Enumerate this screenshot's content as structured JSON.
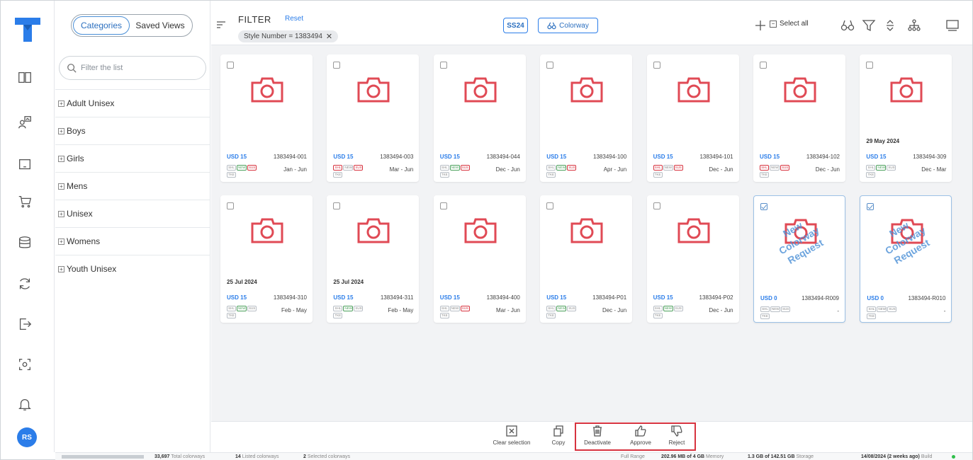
{
  "brand": {
    "logo_color": "#2b7de9",
    "accent": "#2b7de9",
    "highlight": "#d7333f"
  },
  "rail": {
    "icons": [
      "book-icon",
      "people-chart-icon",
      "laptop-icon",
      "cart-icon",
      "database-icon",
      "sync-icon",
      "export-icon",
      "scan-icon",
      "bell-icon"
    ],
    "avatar_initials": "RS"
  },
  "categories": {
    "tabs": {
      "categories": "Categories",
      "saved_views": "Saved Views"
    },
    "search_placeholder": "Filter the list",
    "items": [
      "Adult Unisex",
      "Boys",
      "Girls",
      "Mens",
      "Unisex",
      "Womens",
      "Youth Unisex"
    ]
  },
  "toolbar": {
    "filter_title": "FILTER",
    "reset": "Reset",
    "active_filter": "Style Number = 1383494",
    "season": "SS24",
    "colorway": "Colorway",
    "select_all": "Select all"
  },
  "cards": [
    {
      "price": "USD 15",
      "code": "1383494-001",
      "range": "Jan - Jun",
      "date": "",
      "badges": [
        "SHL",
        "NEW",
        "SUS",
        "TKE"
      ],
      "highlights": {
        "NEW": "green",
        "SUS": "red"
      },
      "selected": false,
      "overlay": false
    },
    {
      "price": "USD 15",
      "code": "1383494-003",
      "range": "Mar - Jun",
      "date": "",
      "badges": [
        "SHL",
        "NEW",
        "SUS",
        "TKE"
      ],
      "highlights": {
        "SHL": "red",
        "SUS": "red"
      },
      "selected": false,
      "overlay": false
    },
    {
      "price": "USD 15",
      "code": "1383494-044",
      "range": "Dec - Jun",
      "date": "",
      "badges": [
        "SHL",
        "NEW",
        "SUS",
        "TKE"
      ],
      "highlights": {
        "NEW": "green",
        "SUS": "red"
      },
      "selected": false,
      "overlay": false
    },
    {
      "price": "USD 15",
      "code": "1383494-100",
      "range": "Apr - Jun",
      "date": "",
      "badges": [
        "SHL",
        "NEW",
        "SUS",
        "TKE"
      ],
      "highlights": {
        "NEW": "green",
        "SUS": "red"
      },
      "selected": false,
      "overlay": false
    },
    {
      "price": "USD 15",
      "code": "1383494-101",
      "range": "Dec - Jun",
      "date": "",
      "badges": [
        "SHL",
        "NEW",
        "SUS",
        "TKE"
      ],
      "highlights": {
        "SHL": "red",
        "SUS": "red"
      },
      "selected": false,
      "overlay": false
    },
    {
      "price": "USD 15",
      "code": "1383494-102",
      "range": "Dec - Jun",
      "date": "",
      "badges": [
        "SHL",
        "NEW",
        "SUS",
        "TKE"
      ],
      "highlights": {
        "SHL": "red",
        "SUS": "red"
      },
      "selected": false,
      "overlay": false
    },
    {
      "price": "USD 15",
      "code": "1383494-309",
      "range": "Dec - Mar",
      "date": "29 May 2024",
      "badges": [
        "SHL",
        "NEW",
        "SUS",
        "TKE"
      ],
      "highlights": {
        "NEW": "green"
      },
      "selected": false,
      "overlay": false
    },
    {
      "price": "USD 15",
      "code": "1383494-310",
      "range": "Feb - May",
      "date": "25 Jul 2024",
      "badges": [
        "SHL",
        "NEW",
        "SUS",
        "TKE"
      ],
      "highlights": {
        "NEW": "green"
      },
      "selected": false,
      "overlay": false
    },
    {
      "price": "USD 15",
      "code": "1383494-311",
      "range": "Feb - May",
      "date": "25 Jul 2024",
      "badges": [
        "SHL",
        "NEW",
        "SUS",
        "TKE"
      ],
      "highlights": {
        "NEW": "green"
      },
      "selected": false,
      "overlay": false
    },
    {
      "price": "USD 15",
      "code": "1383494-400",
      "range": "Mar - Jun",
      "date": "",
      "badges": [
        "SHL",
        "NEW",
        "SUS",
        "TKE"
      ],
      "highlights": {
        "SUS": "red"
      },
      "selected": false,
      "overlay": false
    },
    {
      "price": "USD 15",
      "code": "1383494-P01",
      "range": "Dec - Jun",
      "date": "",
      "badges": [
        "SHL",
        "NEW",
        "SUS",
        "TKE"
      ],
      "highlights": {
        "NEW": "green"
      },
      "selected": false,
      "overlay": false
    },
    {
      "price": "USD 15",
      "code": "1383494-P02",
      "range": "Dec - Jun",
      "date": "",
      "badges": [
        "SHL",
        "NEW",
        "SUS",
        "TKE"
      ],
      "highlights": {
        "NEW": "green"
      },
      "selected": false,
      "overlay": false
    },
    {
      "price": "USD 0",
      "code": "1383494-R009",
      "range": "-",
      "date": "",
      "badges": [
        "SHL",
        "NEW",
        "SUS",
        "TKE"
      ],
      "highlights": {},
      "selected": true,
      "overlay": true
    },
    {
      "price": "USD 0",
      "code": "1383494-R010",
      "range": "-",
      "date": "",
      "badges": [
        "SHL",
        "NEW",
        "SUS",
        "TKE"
      ],
      "highlights": {},
      "selected": true,
      "overlay": true
    }
  ],
  "overlay_text": [
    "New",
    "Colorway",
    "Request"
  ],
  "actions": {
    "clear_selection": "Clear selection",
    "copy": "Copy",
    "deactivate": "Deactivate",
    "approve": "Approve",
    "reject": "Reject"
  },
  "status": {
    "total_count": "33,697",
    "total_label": "Total colorways",
    "listed_count": "14",
    "listed_label": "Listed colorways",
    "selected_count": "2",
    "selected_label": "Selected colorways",
    "range_label": "Full Range",
    "memory_value": "202.96 MB of 4 GB",
    "memory_label": "Memory",
    "storage_value": "1.3 GB of 142.51 GB",
    "storage_label": "Storage",
    "build_value": "14/08/2024 (2 weeks ago)",
    "build_label": "Build"
  }
}
